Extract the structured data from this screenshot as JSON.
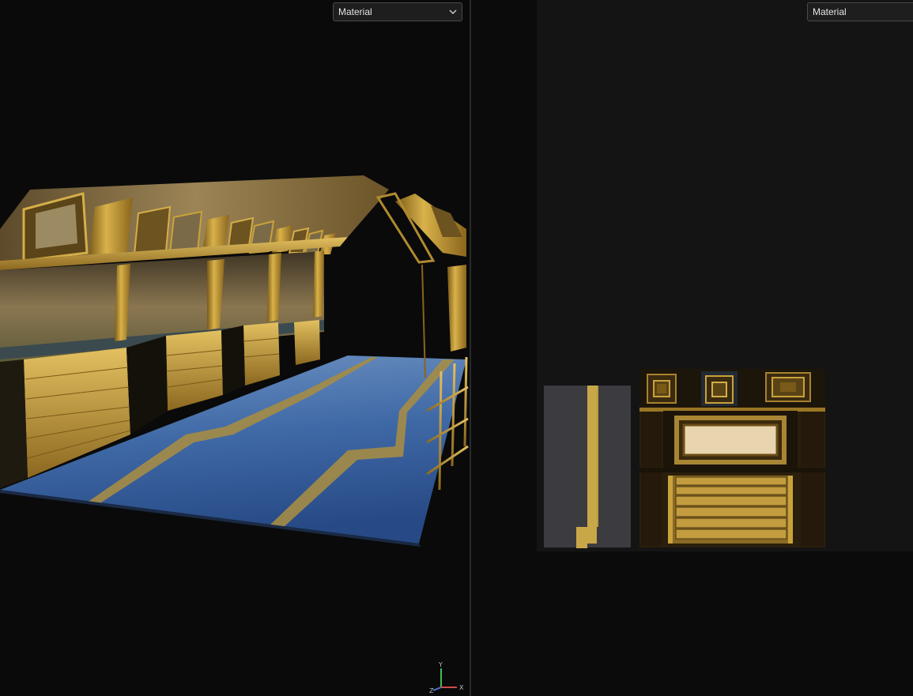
{
  "viewport": {
    "shading_dropdown": {
      "selected": "Material"
    },
    "axis_labels": {
      "y": "Y",
      "x": "X",
      "z": "Z"
    }
  },
  "uv_editor": {
    "shading_dropdown": {
      "selected": "Material"
    }
  },
  "icons": {
    "dropdown_chevron": "chevron-down-icon",
    "axis_gizmo": "axis-gizmo-icon"
  },
  "colors": {
    "gold": "#c9a23a",
    "floor_blue": "#3d6aa8",
    "background": "#0a0a0a",
    "panel": "#141414"
  }
}
